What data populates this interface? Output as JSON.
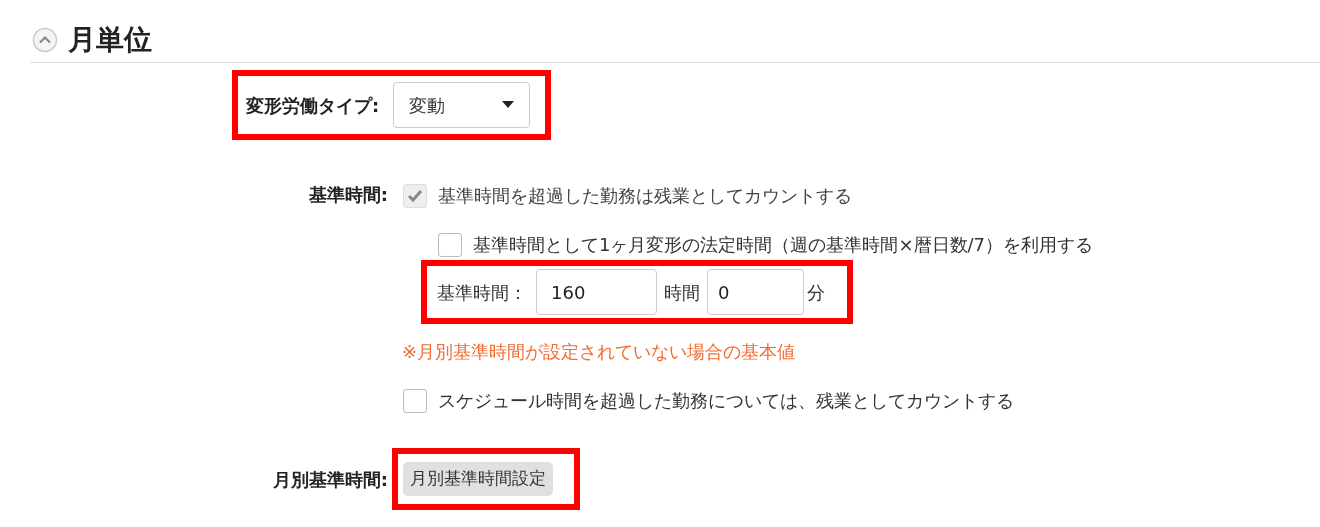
{
  "section": {
    "title": "月単位",
    "expanded": true
  },
  "work_type": {
    "label": "変形労働タイプ:",
    "value": "変動",
    "highlighted": true
  },
  "base_time": {
    "label": "基準時間:",
    "options": [
      {
        "label": "基準時間を超過した勤務は残業としてカウントする",
        "checked": true,
        "disabled": true
      },
      {
        "label": "基準時間として1ヶ月変形の法定時間（週の基準時間×暦日数/7）を利用する",
        "checked": false,
        "disabled": false
      }
    ],
    "hours_row": {
      "label": "基準時間：",
      "hours": "160",
      "hours_unit": "時間",
      "minutes": "0",
      "minutes_unit": "分",
      "highlighted": true
    },
    "note": "※月別基準時間が設定されていない場合の基本値",
    "schedule_option": {
      "label": "スケジュール時間を超過した勤務については、残業としてカウントする",
      "checked": false,
      "disabled": false
    }
  },
  "monthly": {
    "label": "月別基準時間:",
    "button": "月別基準時間設定",
    "highlighted": true
  }
}
